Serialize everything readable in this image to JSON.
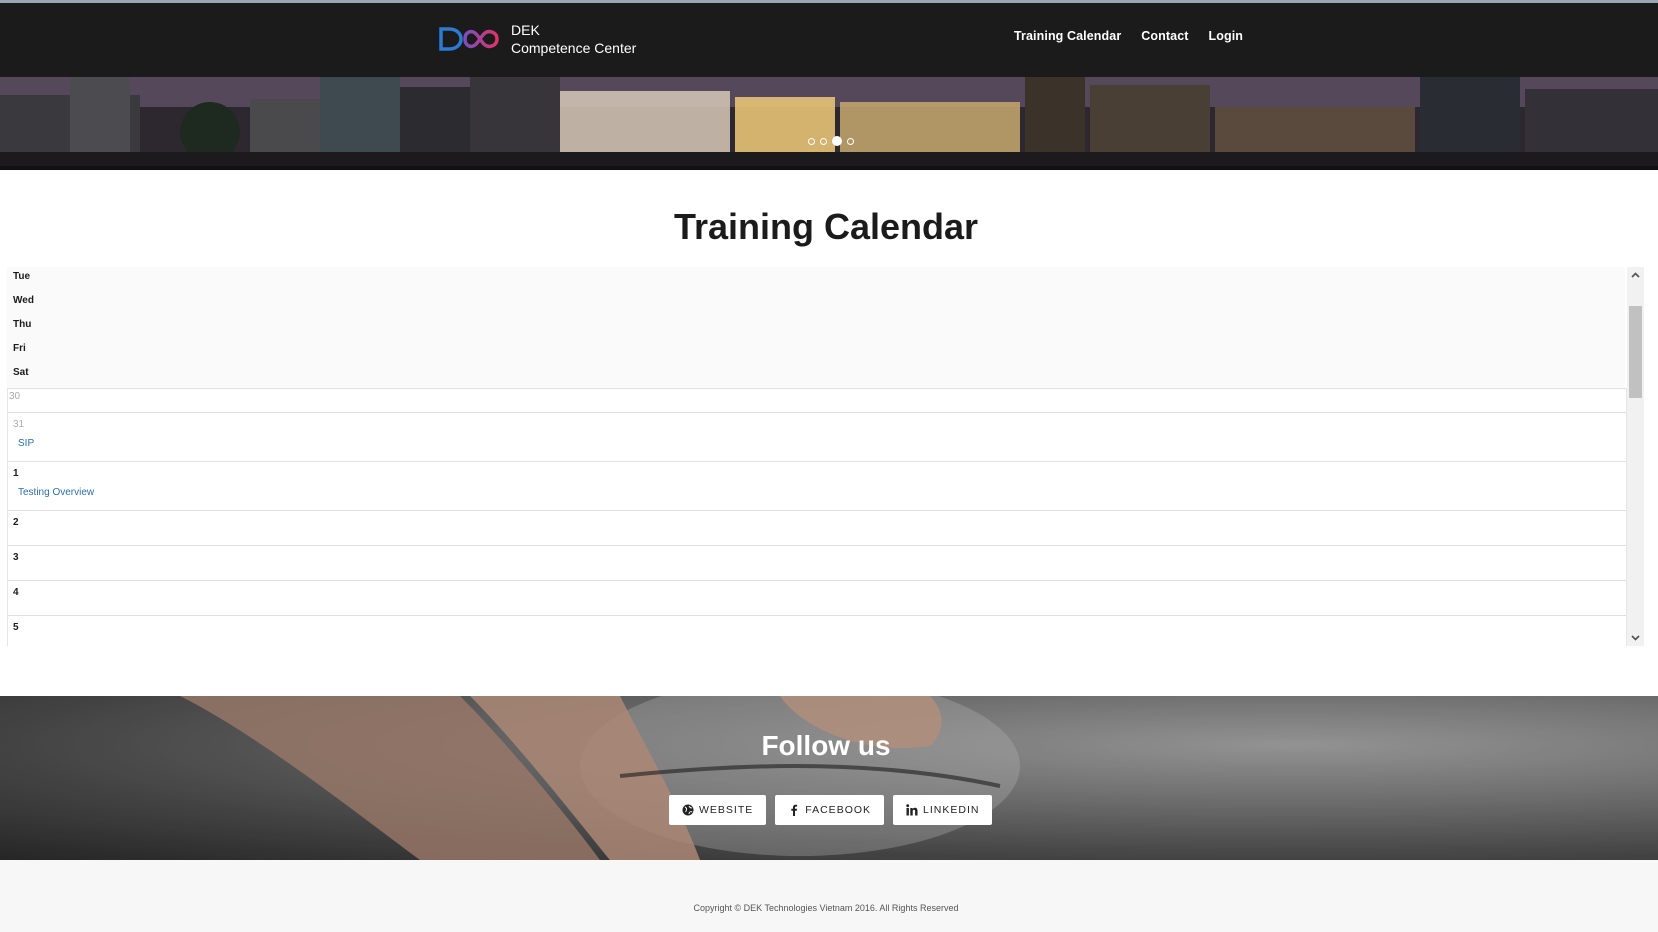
{
  "brand": {
    "name_line1": "DEK",
    "name_line2": "Competence Center",
    "logo_icon": "dek-logo"
  },
  "nav": {
    "items": [
      "Training Calendar",
      "Contact",
      "Login"
    ]
  },
  "hero": {
    "slide_count": 4,
    "active_slide": 3
  },
  "page": {
    "title": "Training Calendar"
  },
  "calendar": {
    "weekdays": [
      "Tue",
      "Wed",
      "Thu",
      "Fri",
      "Sat"
    ],
    "days": [
      {
        "num": "30",
        "muted": true,
        "event": ""
      },
      {
        "num": "31",
        "muted": true,
        "event": "SIP"
      },
      {
        "num": "1",
        "muted": false,
        "event": "Testing Overview"
      },
      {
        "num": "2",
        "muted": false,
        "event": ""
      },
      {
        "num": "3",
        "muted": false,
        "event": ""
      },
      {
        "num": "4",
        "muted": false,
        "event": ""
      },
      {
        "num": "5",
        "muted": false,
        "event": ""
      }
    ]
  },
  "follow": {
    "title": "Follow us",
    "buttons": [
      {
        "label": "WEBSITE",
        "icon": "globe-icon"
      },
      {
        "label": "FACEBOOK",
        "icon": "facebook-icon"
      },
      {
        "label": "LINKEDIN",
        "icon": "linkedin-icon"
      }
    ]
  },
  "footer": {
    "copyright": "Copyright © DEK Technologies Vietnam 2016. All Rights Reserved"
  },
  "colors": {
    "navbar": "#1b1b1b",
    "event_link": "#2f6fa8",
    "accent_logo_blue": "#2a7bd1",
    "accent_logo_pink": "#d6336c"
  }
}
